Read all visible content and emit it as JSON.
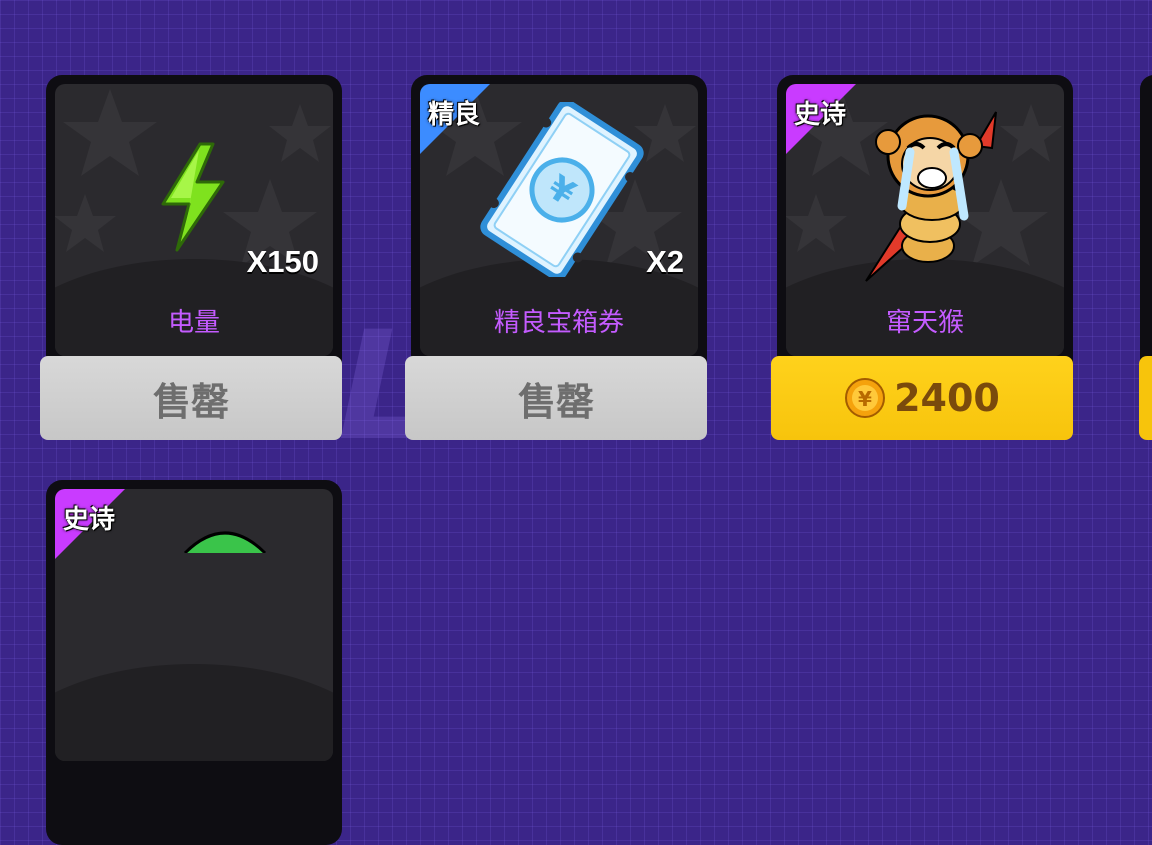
{
  "shop": {
    "items": [
      {
        "name": "电量",
        "quantity": "X150",
        "rarity": "",
        "button": "售罄",
        "button_state": "sold_out",
        "icon": "lightning-bolt-icon"
      },
      {
        "name": "精良宝箱券",
        "quantity": "X2",
        "rarity": "精良",
        "rarity_color": "#3c8cff",
        "button": "售罄",
        "button_state": "sold_out",
        "icon": "ticket-icon"
      },
      {
        "name": "窜天猴",
        "quantity": "",
        "rarity": "史诗",
        "rarity_color": "#c93bff",
        "button": "2400",
        "button_state": "price",
        "icon": "firework-monkey-icon"
      },
      {
        "name": "",
        "quantity": "",
        "rarity": "史诗",
        "rarity_color": "#c93bff",
        "button": "",
        "button_state": "",
        "icon": ""
      }
    ],
    "currency_icon": "coin-icon",
    "colors": {
      "background": "#3b2589",
      "name_text": "#c45bff",
      "sold_out_button": "#d0d0d0",
      "price_button": "#f7c40c"
    }
  }
}
